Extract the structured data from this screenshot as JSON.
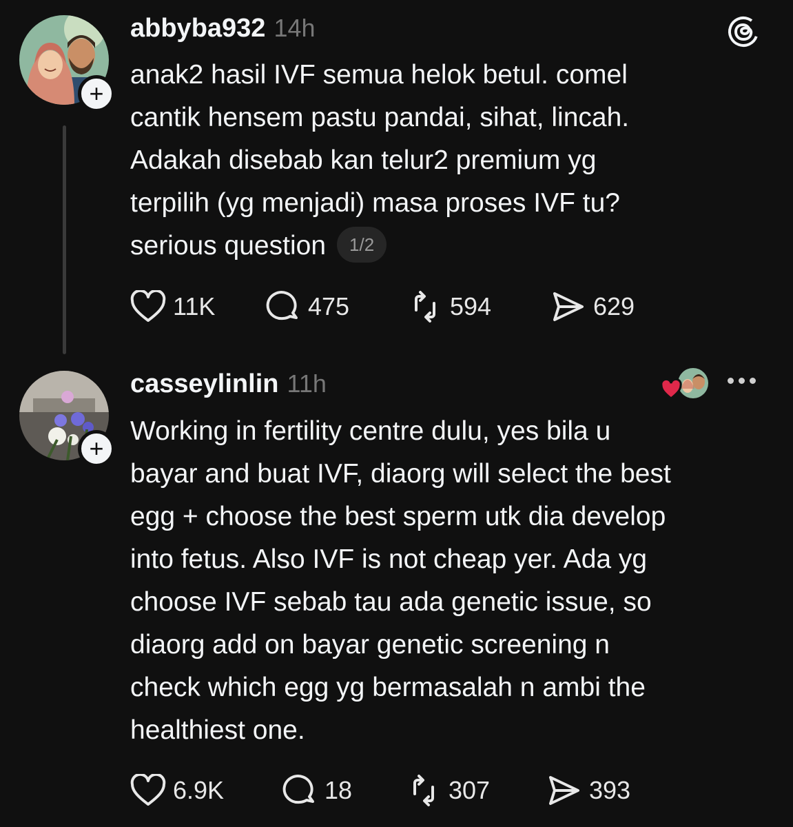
{
  "app": {
    "name": "Threads",
    "icons": {
      "logo": "threads-logo-icon"
    }
  },
  "posts": [
    {
      "username": "abbyba932",
      "time": "14h",
      "text_lines": [
        "anak2 hasil IVF semua helok betul. comel",
        "cantik hensem pastu pandai, sihat, lincah.",
        "Adakah disebab kan telur2 premium yg",
        "terpilih (yg menjadi) masa proses IVF tu?",
        "serious question"
      ],
      "page_indicator": "1/2",
      "likes": "11K",
      "replies": "475",
      "reposts": "594",
      "shares": "629"
    },
    {
      "username": "casseylinlin",
      "time": "11h",
      "text_lines": [
        "Working in fertility centre dulu, yes bila u",
        "bayar and buat IVF, diaorg will select the best",
        "egg + choose the best sperm utk dia develop",
        "into fetus. Also IVF is not cheap yer. Ada yg",
        "choose IVF sebab tau ada genetic issue, so",
        "diaorg add on bayar genetic screening n",
        "check which egg yg bermasalah n ambi the",
        "healthiest one."
      ],
      "likes": "6.9K",
      "replies": "18",
      "reposts": "307",
      "shares": "393"
    }
  ],
  "colors": {
    "background": "#101010",
    "text": "#f3f5f7",
    "muted": "#777777",
    "heart": "#e0284a"
  }
}
